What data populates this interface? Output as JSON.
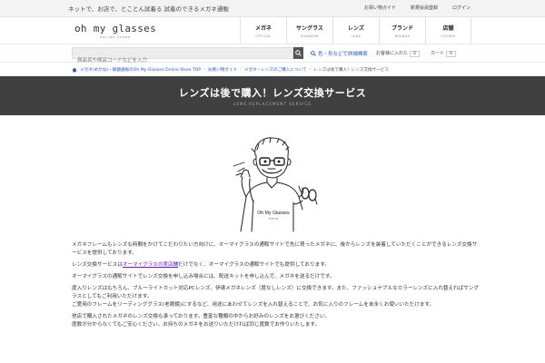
{
  "topbar": {
    "tagline": "ネットで、お店で、とことん試着る 試着のできるメガネ通販",
    "links": [
      "お買い物ガイド",
      "新規会員登録",
      "ログイン"
    ]
  },
  "header": {
    "logo_main": "oh my glasses",
    "logo_sub": "ONLINE STORE",
    "nav": [
      {
        "ja": "メガネ",
        "en": "OPTICAL"
      },
      {
        "ja": "サングラス",
        "en": "SUNWEAR"
      },
      {
        "ja": "レンズ",
        "en": "LENS"
      },
      {
        "ja": "ブランド",
        "en": "BRANDS"
      },
      {
        "ja": "店舗",
        "en": "STORES"
      }
    ]
  },
  "search": {
    "placeholder": "商品名や商品コードなどを入力",
    "advanced_label": "色・形などで詳細検索",
    "recent_label": "お客様に入れた",
    "recent_count": "0",
    "cart_label": "カート",
    "cart_count": "0"
  },
  "breadcrumb": [
    "メガネ(めがね)・眼鏡通販のOh My Glasses Online Store TOP",
    "お買い物ガイド",
    "メガネ・レンズのご購入について",
    "レンズは後で購入！レンズ交換サービス"
  ],
  "banner": {
    "title": "レンズは後で購入！レンズ交換サービス",
    "subtitle": "LENS REPLACEMENT SERVICE"
  },
  "illustration": {
    "shirt_text": "Oh My Glasses",
    "shirt_sub": "TOKYO"
  },
  "content": {
    "p1": "メガネフレームもレンズも時間をかけてこだわりたい方向けに、オーマイグラスの通販サイトで先に買ったメガネに、後からレンズを装着していただくことができるレンズ交換サービスを提供しております。",
    "p2_before": "レンズ交換サービスは",
    "p2_link": "オーマイグラスの実店舗",
    "p2_after": "だけでなく、オーマイグラスの通販サイトでも提供しております。",
    "p3": "オーマイグラスの通販サイトでレンズ交換を申し込み場合には、配送キットを申し込んで、メガネを送るだけです。",
    "p4a": "度入りレンズはもちろん、ブルーライトカット対応PCレンズ、伊達メガネレンズ（度なしレンズ）に交換できます。また、ファッショナブルなカラーレンズに入れ替えればサングラスとしてもご利用いただけます。",
    "p4b": "ご愛用のフレームをリーディンググラス(老眼鏡)にするなど、用途にあわせてレンズを入れ替えることで、お気に入りのフレームを末永くお使いいただけます。",
    "p5a": "他店で購入されたメガネのレンズ交換も承っております。豊富な種類の中からお好みのレンズをお選びください。",
    "p5b": "度数が分からなくてもご安心ください。お持ちのメガネをお送りいただければ同じ度数でお作りいたします。"
  }
}
